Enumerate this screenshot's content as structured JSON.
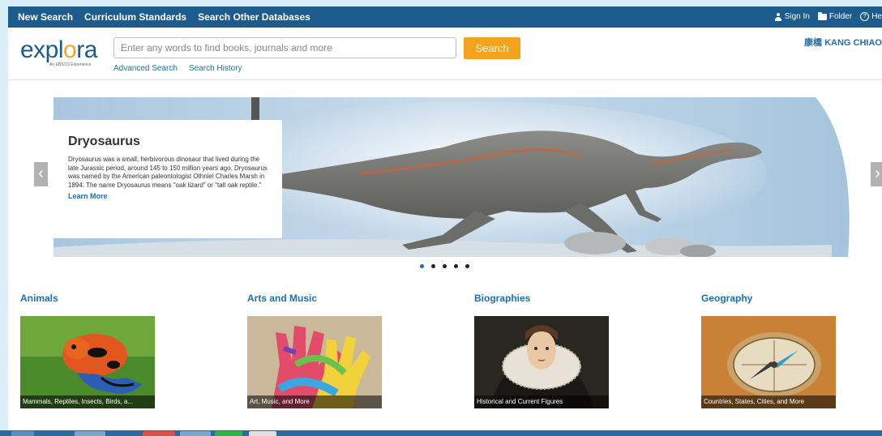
{
  "nav": {
    "links": [
      "New Search",
      "Curriculum Standards",
      "Search Other Databases"
    ],
    "sign_in": "Sign In",
    "folder": "Folder",
    "help": "He"
  },
  "header": {
    "logo_text": "explora",
    "logo_sub": "An EBSCO Experience",
    "search_placeholder": "Enter any words to find books, journals and more",
    "search_button": "Search",
    "advanced_search": "Advanced Search",
    "search_history": "Search History",
    "user_name": "康橋 KANG CHIAO"
  },
  "carousel": {
    "title": "Dryosaurus",
    "description": "Dryosaurus was a small, herbivorous dinosaur that lived during the late Jurassic period, around 145 to 150 million years ago. Dryosaurus was named by the American paleontologist Othniel Charles Marsh in 1894. The name Dryosaurus means \"oak lizard\" or \"tall oak reptile.\"",
    "learn_more": "Learn More",
    "prev_arrow": "‹",
    "next_arrow": "›",
    "active_slide": 1,
    "slide_count": 5
  },
  "categories": [
    {
      "title": "Animals",
      "caption": "Mammals, Reptiles, Insects, Birds, a..."
    },
    {
      "title": "Arts and Music",
      "caption": "Art, Music, and More"
    },
    {
      "title": "Biographies",
      "caption": "Historical and Current Figures"
    },
    {
      "title": "Geography",
      "caption": "Countries, States, Cities, and More"
    }
  ],
  "colors": {
    "nav_bg": "#1d5b8c",
    "accent": "#f5a21c",
    "link": "#1d6fb3"
  }
}
